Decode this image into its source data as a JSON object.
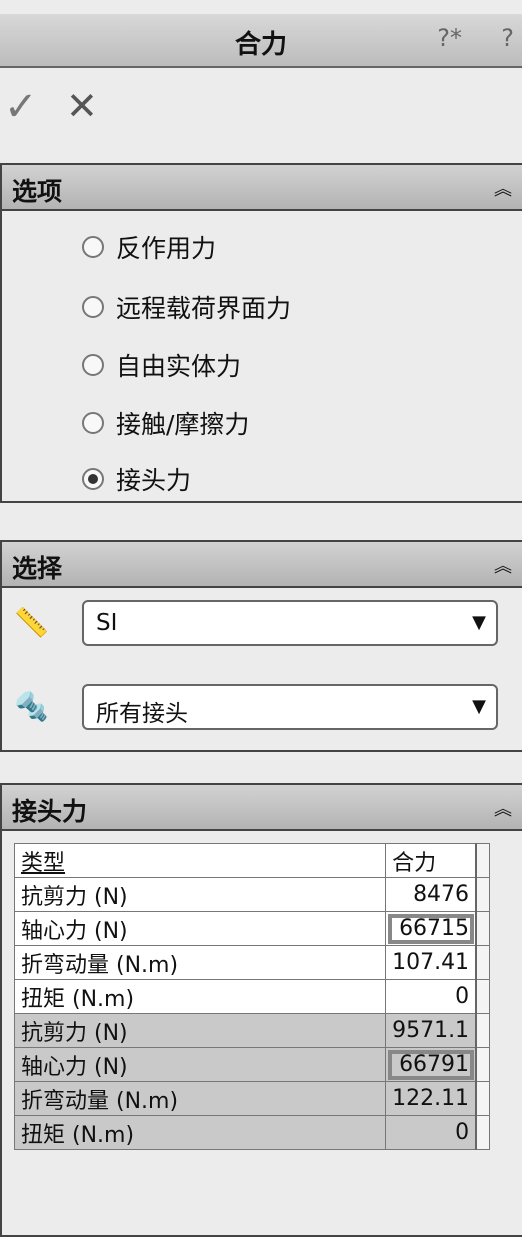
{
  "header": {
    "title": "合力",
    "help_icon_1": "?*",
    "help_icon_2": "?"
  },
  "actions": {
    "ok_icon": "✓",
    "cancel_icon": "✕"
  },
  "options": {
    "title": "选项",
    "items": [
      {
        "label": "反作用力",
        "selected": false
      },
      {
        "label": "远程载荷界面力",
        "selected": false
      },
      {
        "label": "自由实体力",
        "selected": false
      },
      {
        "label": "接触/摩擦力",
        "selected": false
      },
      {
        "label": "接头力",
        "selected": true
      }
    ]
  },
  "selection": {
    "title": "选择",
    "units_value": "SI",
    "connectors_value": "所有接头"
  },
  "joint_forces": {
    "title": "接头力",
    "columns": [
      "类型",
      "合力"
    ],
    "rows": [
      {
        "type": "抗剪力 (N)",
        "value": "8476"
      },
      {
        "type": "轴心力 (N)",
        "value": "66715"
      },
      {
        "type": "折弯动量 (N.m)",
        "value": "107.41"
      },
      {
        "type": "扭矩 (N.m)",
        "value": "0"
      },
      {
        "type": "抗剪力 (N)",
        "value": "9571.1"
      },
      {
        "type": "轴心力 (N)",
        "value": "66791"
      },
      {
        "type": "折弯动量 (N.m)",
        "value": "122.11"
      },
      {
        "type": "扭矩 (N.m)",
        "value": "0"
      }
    ]
  }
}
